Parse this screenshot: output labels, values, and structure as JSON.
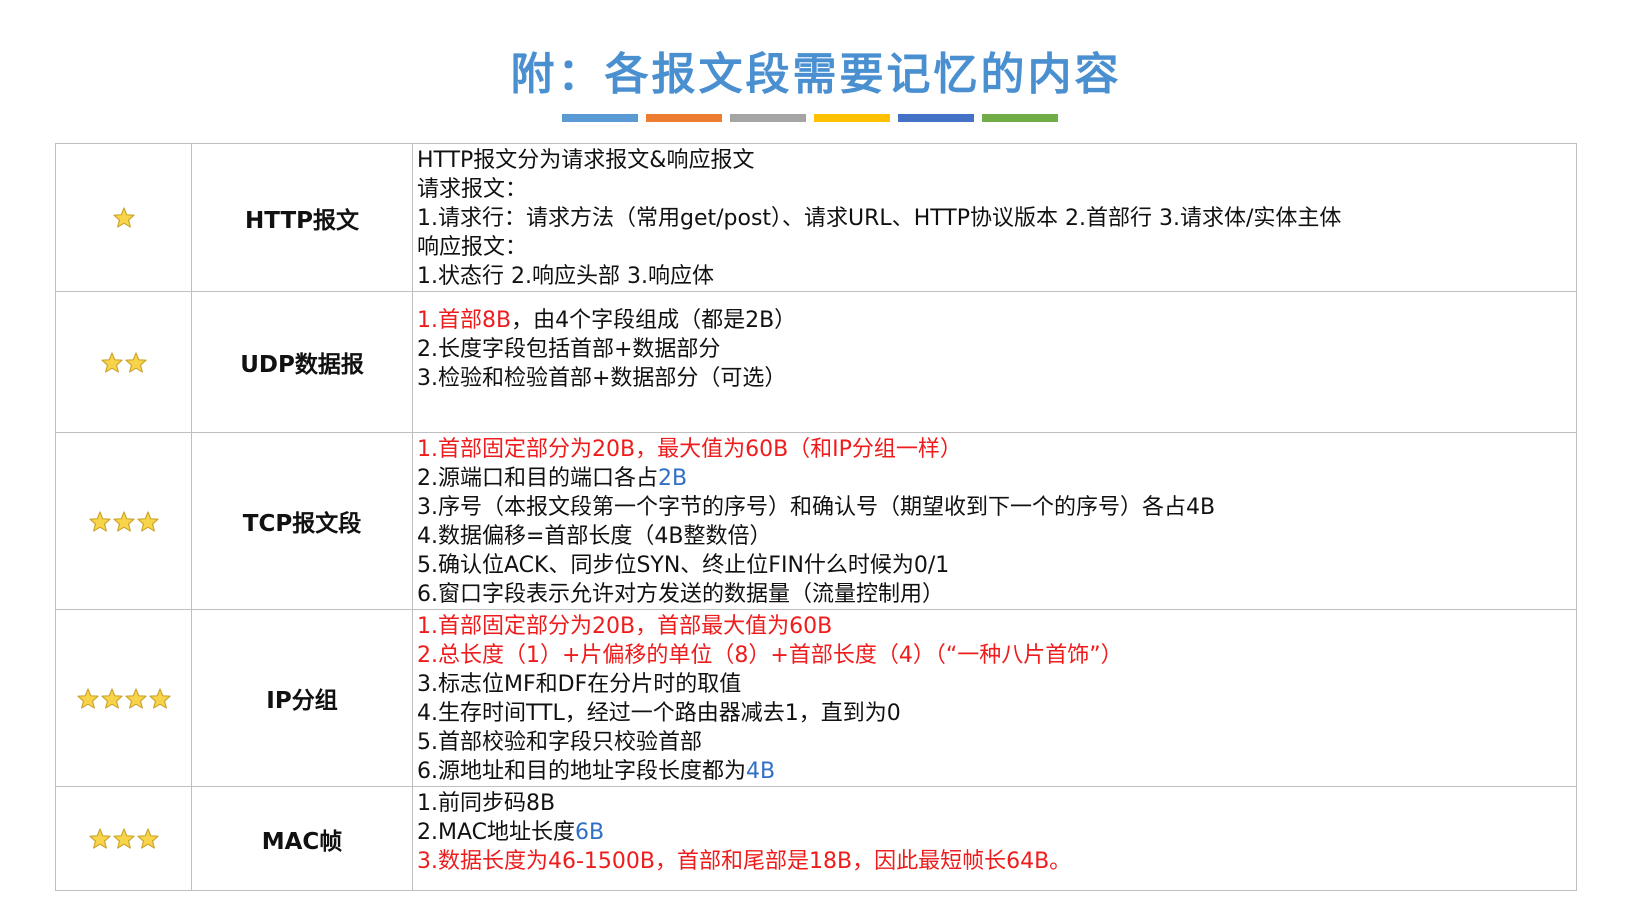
{
  "page": {
    "title": "附：各报文段需要记忆的内容",
    "title_color": "#4a90d0",
    "bar_colors": [
      "#5b9bd5",
      "#ed7d31",
      "#a5a5a5",
      "#ffc000",
      "#4472c4",
      "#70ad47"
    ]
  },
  "colors": {
    "red": "#ee1c1c",
    "blue": "#2f6fc6",
    "black": "#111111",
    "star_fill": "#f8d44a",
    "star_stroke": "#c9a227"
  },
  "icons": {
    "rating": "star-icon"
  },
  "rows": [
    {
      "stars": 1,
      "name": "HTTP报文",
      "height": 140,
      "lines": [
        [
          {
            "t": "HTTP报文分为请求报文&响应报文",
            "c": "black"
          }
        ],
        [
          {
            "t": "请求报文：",
            "c": "black"
          }
        ],
        [
          {
            "t": "1.请求行：请求方法（常用get/post）、请求URL、HTTP协议版本 2.首部行 3.请求体/实体主体",
            "c": "black"
          }
        ],
        [
          {
            "t": "响应报文：",
            "c": "black"
          }
        ],
        [
          {
            "t": "1.状态行 2.响应头部 3.响应体",
            "c": "black"
          }
        ]
      ]
    },
    {
      "stars": 2,
      "name": "UDP数据报",
      "height": 141,
      "lines": [
        [],
        [
          {
            "t": "1.首部8B",
            "c": "red"
          },
          {
            "t": "，由4个字段组成（都是2B）",
            "c": "black"
          }
        ],
        [
          {
            "t": "2.长度字段包括首部+数据部分",
            "c": "black"
          }
        ],
        [
          {
            "t": "3.检验和检验首部+数据部分（可选）",
            "c": "black"
          }
        ]
      ]
    },
    {
      "stars": 3,
      "name": "TCP报文段",
      "height": 172,
      "lines": [
        [
          {
            "t": "1.首部固定部分为20B，最大值为60B（和IP分组一样）",
            "c": "red"
          }
        ],
        [
          {
            "t": "2.源端口和目的端口各占",
            "c": "black"
          },
          {
            "t": "2B",
            "c": "blue"
          }
        ],
        [
          {
            "t": "3.序号（本报文段第一个字节的序号）和确认号（期望收到下一个的序号）各占4B",
            "c": "black"
          }
        ],
        [
          {
            "t": "4.数据偏移=首部长度（4B整数倍）",
            "c": "black"
          }
        ],
        [
          {
            "t": "5.确认位ACK、同步位SYN、终止位FIN什么时候为0/1",
            "c": "black"
          }
        ],
        [
          {
            "t": "6.窗口字段表示允许对方发送的数据量（流量控制用）",
            "c": "black"
          }
        ]
      ]
    },
    {
      "stars": 4,
      "name": "IP分组",
      "height": 172,
      "lines": [
        [
          {
            "t": "1.首部固定部分为20B，首部最大值为60B",
            "c": "red"
          }
        ],
        [
          {
            "t": "2.总长度（1）+片偏移的单位（8）+首部长度（4）（“一种八片首饰”）",
            "c": "red"
          }
        ],
        [
          {
            "t": "3.标志位MF和DF在分片时的取值",
            "c": "black"
          }
        ],
        [
          {
            "t": "4.生存时间TTL，经过一个路由器减去1，直到为0",
            "c": "black"
          }
        ],
        [
          {
            "t": "5.首部校验和字段只校验首部",
            "c": "black"
          }
        ],
        [
          {
            "t": "6.源地址和目的地址字段长度都为",
            "c": "black"
          },
          {
            "t": "4B",
            "c": "blue"
          }
        ]
      ]
    },
    {
      "stars": 3,
      "name": "MAC帧",
      "height": 104,
      "lines": [
        [
          {
            "t": "1.前同步码8B",
            "c": "black"
          }
        ],
        [
          {
            "t": "2.MAC地址长度",
            "c": "black"
          },
          {
            "t": "6B",
            "c": "blue"
          }
        ],
        [
          {
            "t": "3.数据长度为46-1500B，首部和尾部是18B，因此最短帧长64B。",
            "c": "red"
          }
        ]
      ]
    }
  ]
}
